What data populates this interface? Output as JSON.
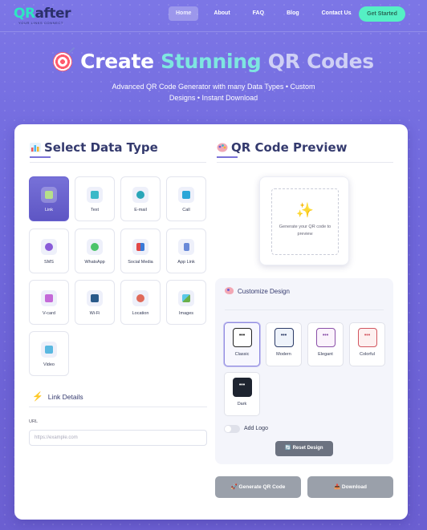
{
  "nav": {
    "logo_qr": "QR",
    "logo_after": "after",
    "logo_tagline": "YOUR LINKS CONNECT",
    "links": [
      "Home",
      "About",
      "FAQ",
      "Blog",
      "Contact Us"
    ],
    "active_link": "Home",
    "cta_label": "Get Started"
  },
  "hero": {
    "title_part1": "Create",
    "title_part2": "Stunning",
    "title_part3": "QR Codes",
    "subtitle_line1": "Advanced QR Code Generator with many Data Types • Custom",
    "subtitle_line2": "Designs • Instant Download"
  },
  "data_type": {
    "title": "Select Data Type",
    "tiles": [
      {
        "label": "Link",
        "icon": "link-icon",
        "active": true
      },
      {
        "label": "Text",
        "icon": "text-icon"
      },
      {
        "label": "E-mail",
        "icon": "email-icon"
      },
      {
        "label": "Call",
        "icon": "phone-icon"
      },
      {
        "label": "SMS",
        "icon": "sms-icon"
      },
      {
        "label": "WhatsApp",
        "icon": "whatsapp-icon"
      },
      {
        "label": "Social Media",
        "icon": "social-icon"
      },
      {
        "label": "App Link",
        "icon": "app-link-icon"
      },
      {
        "label": "V-card",
        "icon": "vcard-icon"
      },
      {
        "label": "Wi-Fi",
        "icon": "wifi-icon"
      },
      {
        "label": "Location",
        "icon": "location-icon"
      },
      {
        "label": "Images",
        "icon": "images-icon"
      },
      {
        "label": "Video",
        "icon": "video-icon"
      }
    ]
  },
  "link_details": {
    "title": "Link Details",
    "url_label": "URL",
    "url_placeholder": "https://example.com",
    "url_value": ""
  },
  "preview": {
    "title": "QR Code Preview",
    "placeholder_text": "Generate your QR code to preview"
  },
  "customize": {
    "title": "Customize Design",
    "styles": [
      {
        "label": "Classic",
        "active": true,
        "border": "#222222",
        "bg": "#ffffff"
      },
      {
        "label": "Modern",
        "border": "#2b3a66",
        "bg": "#eef3fb"
      },
      {
        "label": "Elegant",
        "border": "#8a4fa8",
        "bg": "#fbf3fc"
      },
      {
        "label": "Colorful",
        "border": "#d2555f",
        "bg": "#fdf0f0"
      },
      {
        "label": "Dark",
        "border": "#1e2430",
        "bg": "#1e2430",
        "dark": true
      }
    ],
    "swatch_glyph": "•••",
    "add_logo_label": "Add Logo",
    "add_logo_on": false,
    "reset_label": "Reset Design"
  },
  "actions": {
    "generate_label": "Generate QR Code",
    "download_label": "Download"
  }
}
